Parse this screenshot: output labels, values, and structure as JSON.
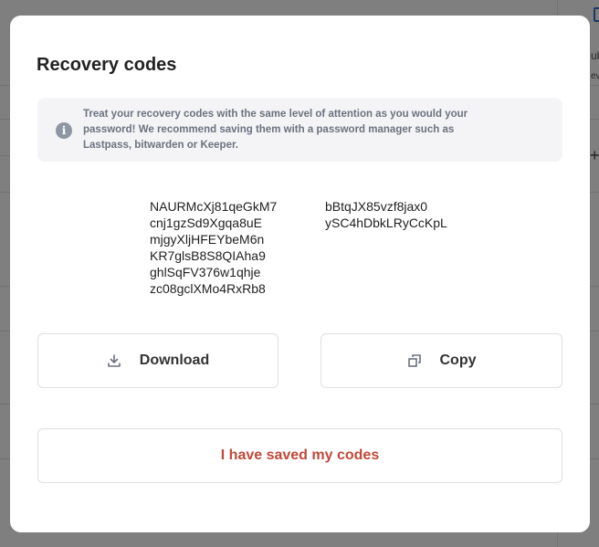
{
  "background": {
    "partial_text_1": "ub",
    "partial_text_2": "ev",
    "plus_glyph": "+"
  },
  "modal": {
    "title": "Recovery codes",
    "info": {
      "icon": "info-icon",
      "text": "Treat your recovery codes with the same level of attention as you would your password! We recommend saving them with a password manager such as Lastpass, bitwarden or Keeper."
    },
    "codes_col1": [
      "NAURMcXj81qeGkM7",
      "cnj1gzSd9Xgqa8uE",
      "mjgyXljHFEYbeM6n",
      "KR7glsB8S8QIAha9",
      "ghlSqFV376w1qhje",
      "zc08gclXMo4RxRb8"
    ],
    "codes_col2": [
      "bBtqJX85vzf8jax0",
      "ySC4hDbkLRyCcKpL"
    ],
    "buttons": {
      "download_label": "Download",
      "download_icon": "download-icon",
      "copy_label": "Copy",
      "copy_icon": "copy-icon",
      "saved_label": "I have saved my codes"
    },
    "colors": {
      "accent_red": "#c0493a",
      "info_bg": "#f4f4f6"
    }
  }
}
